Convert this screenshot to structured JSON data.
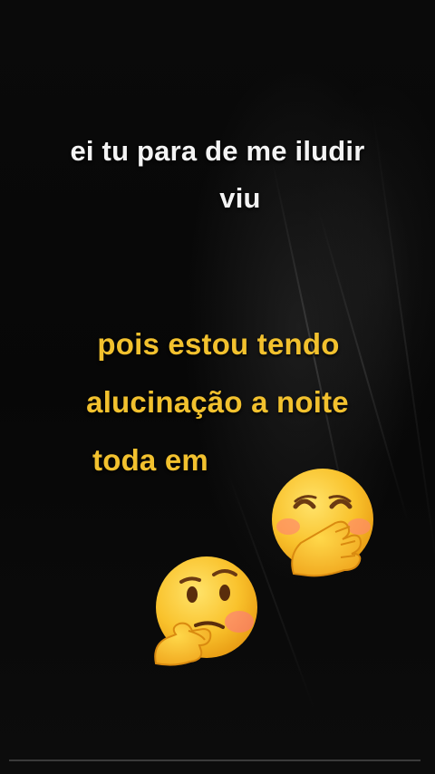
{
  "caption_white": {
    "line1": "ei tu para de me iludir",
    "line2": "viu"
  },
  "caption_yellow": {
    "line1": "pois estou tendo",
    "line2": "alucinação a noite",
    "line3": "toda em"
  },
  "emojis": [
    {
      "name": "face-with-hand-over-mouth-emoji"
    },
    {
      "name": "thinking-face-emoji"
    }
  ],
  "colors": {
    "background": "#050505",
    "caption_white": "#f4f4f4",
    "caption_yellow": "#f2c12e"
  }
}
